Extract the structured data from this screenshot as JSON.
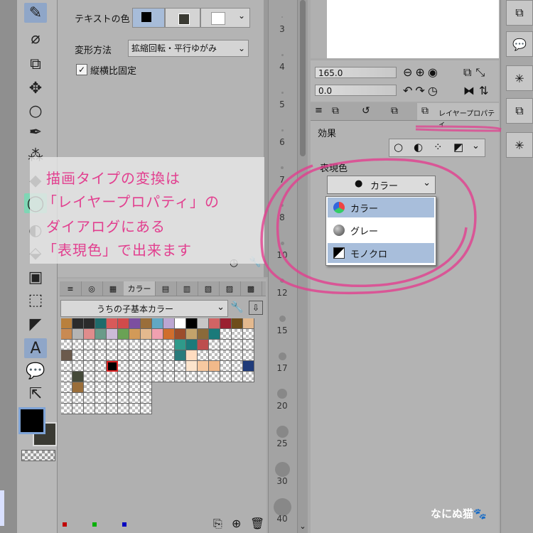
{
  "tool_property": {
    "text_color_label": "テキストの色",
    "transform_label": "変形方法",
    "transform_value": "拡縮回転・平行ゆがみ",
    "keep_ratio_label": "縦横比固定"
  },
  "annotation": {
    "lines": [
      "描画タイプの変換は",
      "「レイヤープロパティ」の",
      "ダイアログにある",
      "「表現色」で出来ます"
    ]
  },
  "color_set": {
    "tab_label": "カラー",
    "set_name": "うちの子基本カラー",
    "top_colors": [
      "#b9803c",
      "#2b2b2b",
      "#2b2b2b",
      "#1e6b6b",
      "#d85a5a",
      "#d14b4b",
      "#7c4fa0",
      "#9a6e3a",
      "#61a8c4",
      "#bba6d2",
      "#ffffff",
      "#000000",
      "#c6c6c6",
      "#d26464",
      "#9a2030",
      "#6e4d1a",
      "#e4b98e",
      "#f0d832"
    ],
    "second_colors": [
      "#c98a52",
      "#b4b4b4",
      "#e08c8c",
      "#6a9b8a",
      "#cbbbd7",
      "#6aa255",
      "#d29a58",
      "#e4b98e",
      "#f0a0b0",
      "#d06e2d",
      "#9b4d2b",
      "#c3a36b",
      "#8a6a3a",
      "#1a7a7a"
    ]
  },
  "brush_sizes": [
    "3",
    "4",
    "5",
    "6",
    "7",
    "8",
    "10",
    "12",
    "15",
    "17",
    "20",
    "25",
    "30",
    "40"
  ],
  "navigator": {
    "zoom": "165.0",
    "angle": "0.0"
  },
  "layer_property": {
    "tab_label": "レイヤープロパティ",
    "effect_label": "効果",
    "expression_label": "表現色",
    "expression_value": "カラー",
    "options": [
      "カラー",
      "グレー",
      "モノクロ"
    ]
  },
  "watermark": "なにぬ猫🐾",
  "colors": {
    "highlight_pink": "#e23f8f",
    "selected_option": "#a8bedb",
    "accent_blue": "#7ea3d6"
  }
}
